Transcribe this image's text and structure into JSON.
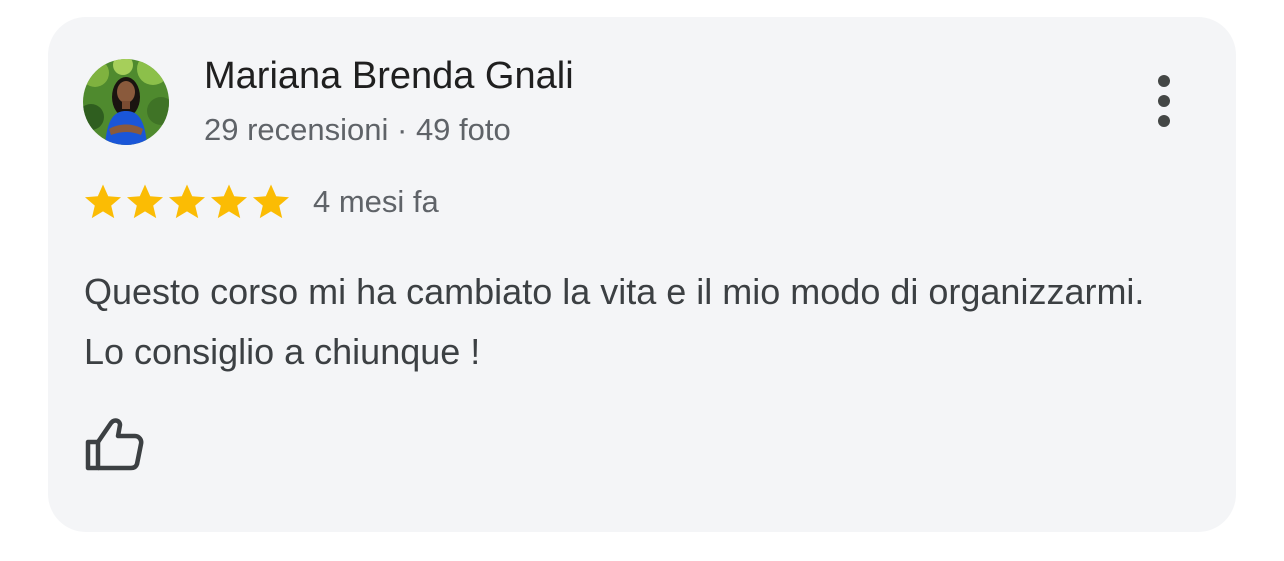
{
  "review": {
    "author_name": "Mariana Brenda Gnali",
    "author_meta": "29 recensioni · 49 foto",
    "rating": 5,
    "max_rating": 5,
    "date": "4 mesi fa",
    "text": "Questo corso mi ha cambiato la vita e il mio modo di organizzarmi. Lo consiglio a chiunque !"
  },
  "colors": {
    "card_background": "#f4f5f7",
    "star": "#fbbc04",
    "name_text": "#1f1f1f",
    "secondary_text": "#5f6368",
    "body_text": "#3c4043",
    "avatar_dress": "#1a56d8"
  },
  "icons": {
    "more": "more-vertical-icon",
    "like": "thumb-up-icon",
    "star": "star-icon"
  }
}
